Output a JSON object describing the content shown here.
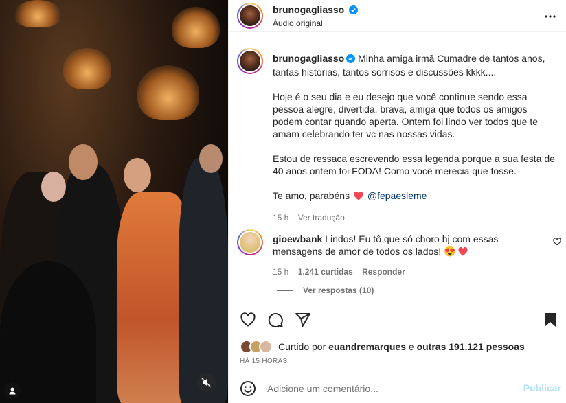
{
  "post": {
    "username": "brunogagliasso",
    "audio": "Áudio original",
    "caption_p1": "Minha amiga irmã Cumadre de tantos anos, tantas histórias, tantos sorrisos e discussões kkkk....",
    "caption_p2": "Hoje é o seu dia e eu desejo que você continue sendo essa pessoa alegre, divertida, brava, amiga que todos os amigos podem contar quando aperta. Ontem foi lindo ver todos que te amam celebrando ter vc nas nossas vidas.",
    "caption_p3": "Estou de ressaca escrevendo essa legenda porque a sua festa de 40 anos ontem foi FODA! Como você merecia que fosse.",
    "caption_p4": "Te amo, parabéns",
    "caption_mention": "@fepaesleme",
    "caption_time": "15 h",
    "see_translation": "Ver tradução"
  },
  "comment": {
    "username": "gioewbank",
    "text": "Lindos! Eu tô que só choro hj com essas mensagens de amor de todos os lados! 😍",
    "time": "15 h",
    "likes": "1.241 curtidas",
    "reply": "Responder",
    "view_replies": "Ver respostas (10)"
  },
  "engagement": {
    "liked_by_prefix": "Curtido por",
    "liked_by_user": "euandremarques",
    "liked_by_middle": "e",
    "liked_by_others": "outras 191.121 pessoas",
    "time_ago": "HÁ 15 HORAS"
  },
  "comment_box": {
    "placeholder": "Adicione um comentário...",
    "publish": "Publicar"
  },
  "colors": {
    "heart": "#ed4956",
    "mention": "#00376b",
    "verified": "#0095f6",
    "publish_disabled": "#b2dffc"
  }
}
